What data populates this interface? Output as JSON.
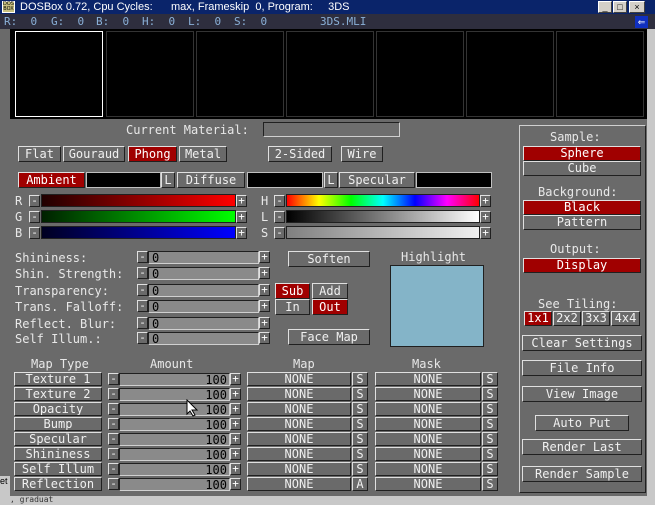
{
  "window": {
    "title": "DOSBox 0.72, Cpu Cycles:      max, Frameskip  0, Program:     3DS",
    "icon_text": "DOS BOX",
    "min": "_",
    "max": "□",
    "close": "×"
  },
  "status": {
    "r": "R:  0",
    "g": "G:  0",
    "b": "B:  0",
    "h": "H:  0",
    "l": "L:  0",
    "s": "S:  0",
    "file": "3DS.MLI",
    "arrow": "⇐"
  },
  "material": {
    "label": "Current Material:",
    "value": ""
  },
  "shading": {
    "flat": "Flat",
    "gouraud": "Gouraud",
    "phong": "Phong",
    "metal": "Metal",
    "selected": "Phong",
    "two_sided": "2-Sided",
    "wire": "Wire"
  },
  "color_tabs": {
    "ambient": "Ambient",
    "diffuse": "Diffuse",
    "specular": "Specular",
    "l": "L"
  },
  "sliders": {
    "r": "R",
    "g": "G",
    "b": "B",
    "h": "H",
    "l": "L",
    "s": "S",
    "minus": "-",
    "plus": "+"
  },
  "properties": [
    {
      "label": "Shininess:",
      "value": "0"
    },
    {
      "label": "Shin. Strength:",
      "value": "0"
    },
    {
      "label": "Transparency:",
      "value": "0"
    },
    {
      "label": "Trans. Falloff:",
      "value": "0"
    },
    {
      "label": "Reflect. Blur:",
      "value": "0"
    },
    {
      "label": "Self Illum.:",
      "value": "0"
    }
  ],
  "buttons": {
    "soften": "Soften",
    "highlight": "Highlight",
    "sub": "Sub",
    "add": "Add",
    "in": "In",
    "out": "Out",
    "face_map": "Face Map"
  },
  "maps": {
    "headers": {
      "type": "Map Type",
      "amount": "Amount",
      "map": "Map",
      "mask": "Mask"
    },
    "rows": [
      {
        "type": "Texture 1",
        "amount": "100",
        "map": "NONE",
        "map_flag": "S",
        "mask": "NONE",
        "mask_flag": "S"
      },
      {
        "type": "Texture 2",
        "amount": "100",
        "map": "NONE",
        "map_flag": "S",
        "mask": "NONE",
        "mask_flag": "S"
      },
      {
        "type": "Opacity",
        "amount": "100",
        "map": "NONE",
        "map_flag": "S",
        "mask": "NONE",
        "mask_flag": "S"
      },
      {
        "type": "Bump",
        "amount": "100",
        "map": "NONE",
        "map_flag": "S",
        "mask": "NONE",
        "mask_flag": "S"
      },
      {
        "type": "Specular",
        "amount": "100",
        "map": "NONE",
        "map_flag": "S",
        "mask": "NONE",
        "mask_flag": "S"
      },
      {
        "type": "Shininess",
        "amount": "100",
        "map": "NONE",
        "map_flag": "S",
        "mask": "NONE",
        "mask_flag": "S"
      },
      {
        "type": "Self Illum",
        "amount": "100",
        "map": "NONE",
        "map_flag": "S",
        "mask": "NONE",
        "mask_flag": "S"
      },
      {
        "type": "Reflection",
        "amount": "100",
        "map": "NONE",
        "map_flag": "A",
        "mask": "NONE",
        "mask_flag": "S"
      }
    ]
  },
  "right_panel": {
    "sample_label": "Sample:",
    "sphere": "Sphere",
    "cube": "Cube",
    "background_label": "Background:",
    "black": "Black",
    "pattern": "Pattern",
    "output_label": "Output:",
    "display": "Display",
    "tiling_label": "See Tiling:",
    "t1": "1x1",
    "t2": "2x2",
    "t3": "3x3",
    "t4": "4x4",
    "clear": "Clear Settings",
    "file_info": "File Info",
    "view_image": "View Image",
    "auto_put": "Auto Put",
    "render_last": "Render Last",
    "render_sample": "Render Sample"
  },
  "edge_text": {
    "left": "et",
    "bottom": ", graduat"
  },
  "colors": {
    "accent_red": "#a00000",
    "panel_gray": "#6a6a6a",
    "highlight_swatch": "#84b4c8",
    "title_blue": "#0a246a"
  }
}
